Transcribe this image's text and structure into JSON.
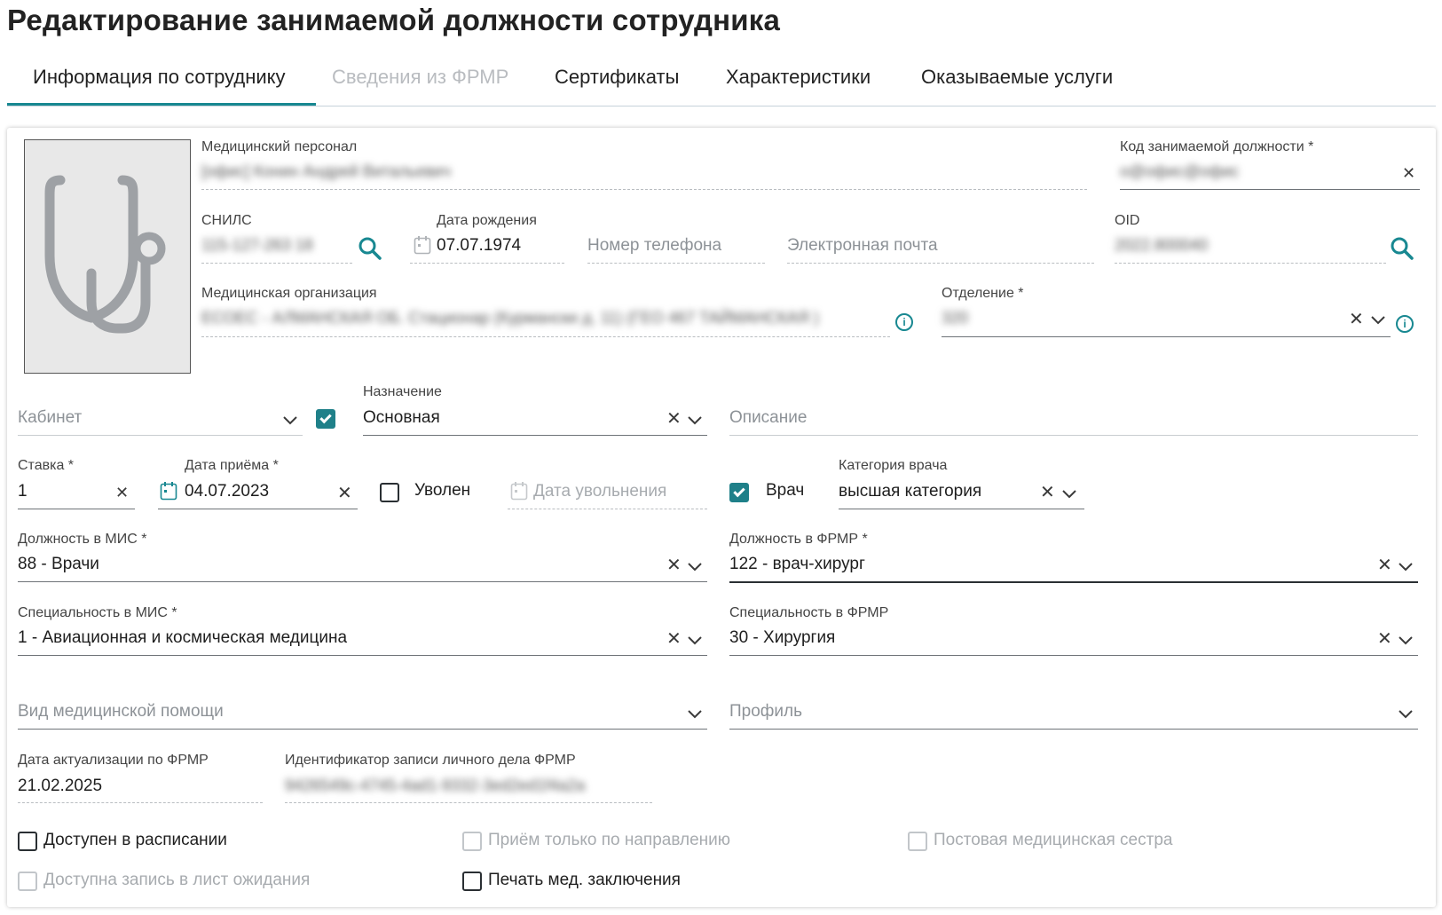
{
  "page_title": "Редактирование занимаемой должности сотрудника",
  "tabs": [
    {
      "label": "Информация по сотруднику",
      "active": true
    },
    {
      "label": "Сведения из ФРМР",
      "disabled": true
    },
    {
      "label": "Сертификаты"
    },
    {
      "label": "Характеристики"
    },
    {
      "label": "Оказываемые услуги"
    }
  ],
  "colors": {
    "accent": "#188891",
    "checkbox_checked": "#1f8089",
    "disabled_text": "#b9bcc0"
  },
  "fields": {
    "medical_staff": {
      "label": "Медицинский персонал",
      "value": "[офис] Конин Андрей Витальевич"
    },
    "position_code": {
      "label": "Код занимаемой должности *",
      "value": "о@офис@офис"
    },
    "snils": {
      "label": "СНИЛС",
      "value": "115-127-263 18"
    },
    "birth_date": {
      "label": "Дата рождения",
      "value": "07.07.1974"
    },
    "phone": {
      "placeholder": "Номер телефона"
    },
    "email": {
      "placeholder": "Электронная почта"
    },
    "oid": {
      "label": "OID",
      "value": "2022.800040"
    },
    "med_org": {
      "label": "Медицинская организация",
      "value": "ЕСОЕС - АЛМАНСКАЯ ОБ. Стационар (Курмански д. 11) (ГЕО 467 ТАЙМАНСКАЯ )"
    },
    "department": {
      "label": "Отделение *",
      "value": "320"
    },
    "cabinet": {
      "placeholder": "Кабинет"
    },
    "assignment": {
      "label": "Назначение",
      "value": "Основная"
    },
    "description": {
      "placeholder": "Описание"
    },
    "rate": {
      "label": "Ставка *",
      "value": "1"
    },
    "hire_date": {
      "label": "Дата приёма *",
      "value": "04.07.2023"
    },
    "fired": {
      "label": "Уволен"
    },
    "dismissal_date": {
      "placeholder": "Дата увольнения"
    },
    "doctor": {
      "label": "Врач"
    },
    "doctor_category": {
      "label": "Категория врача",
      "value": "высшая категория"
    },
    "mis_position": {
      "label": "Должность в МИС *",
      "value": "88 - Врачи"
    },
    "frmr_position": {
      "label": "Должность в ФРМР *",
      "value": "122 - врач-хирург"
    },
    "mis_specialty": {
      "label": "Специальность в МИС *",
      "value": "1 - Авиационная и космическая медицина"
    },
    "frmr_specialty": {
      "label": "Специальность в ФРМР",
      "value": "30 - Хирургия"
    },
    "care_type": {
      "placeholder": "Вид медицинской помощи"
    },
    "profile": {
      "placeholder": "Профиль"
    },
    "frmr_update_date": {
      "label": "Дата актуализации по ФРМР",
      "value": "21.02.2025"
    },
    "frmr_record_id": {
      "label": "Идентификатор записи личного дела ФРМР",
      "value": "9426549с-4745-4ad1-9332-3ed2ed1f4a2a"
    }
  },
  "checkboxes": {
    "available_schedule": "Доступен в расписании",
    "referral_only": "Приём только по направлению",
    "ward_nurse": "Постовая медицинская сестра",
    "waitlist": "Доступна запись в лист ожидания",
    "print_conclusion": "Печать мед. заключения"
  },
  "icons": {
    "clear": "✕",
    "chevron": "chevron-down-icon",
    "search": "search-icon",
    "calendar": "calendar-icon",
    "info": "i"
  }
}
